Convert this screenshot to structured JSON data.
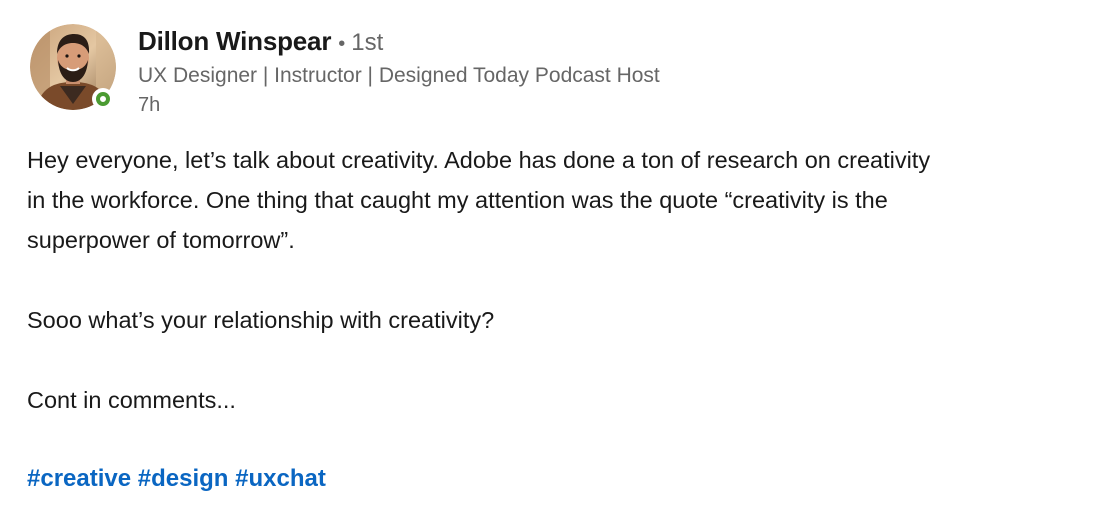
{
  "author": {
    "name": "Dillon Winspear",
    "bullet": "•",
    "degree": "1st",
    "headline": "UX Designer | Instructor | Designed Today Podcast Host",
    "time": "7h",
    "presence": "online"
  },
  "post": {
    "lines": [
      "Hey everyone, let’s talk about creativity. Adobe has done a ton of research on creativity",
      "in the workforce. One thing that caught my attention was the quote “creativity is the",
      "superpower of tomorrow”."
    ],
    "question": "Sooo what’s your relationship with creativity?",
    "continuation": "Cont in comments...",
    "hashtags": [
      "#creative",
      "#design",
      "#uxchat"
    ]
  },
  "colors": {
    "link": "#0a66c2",
    "presence": "#4b9b32",
    "secondary_text": "#666666",
    "primary_text": "#191919"
  },
  "icons": {
    "avatar": "avatar-photo",
    "presence": "online-status-icon"
  }
}
